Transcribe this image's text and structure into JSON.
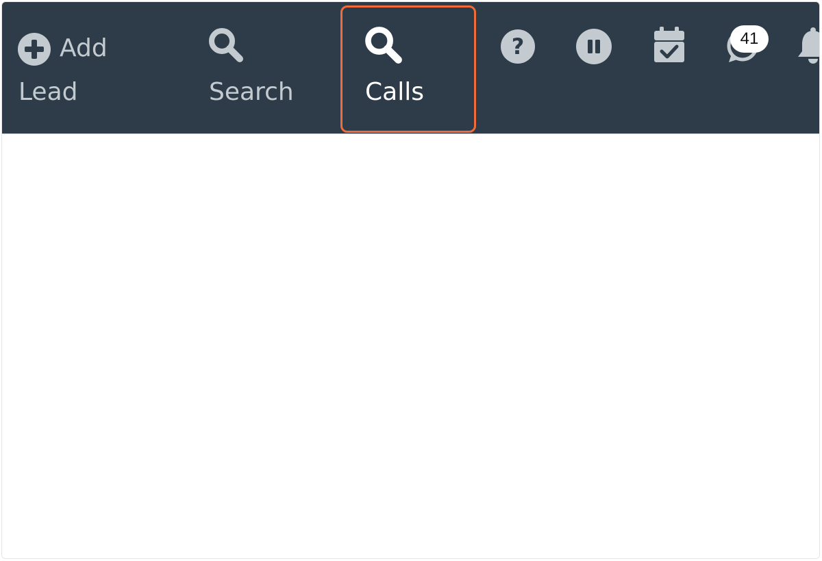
{
  "navbar": {
    "add_lead": {
      "line1": "Add",
      "line2": "Lead",
      "icon": "plus-circle-icon"
    },
    "search": {
      "label": "Search",
      "icon": "search-icon"
    },
    "calls": {
      "label": "Calls",
      "icon": "search-icon",
      "highlighted": true
    },
    "help": {
      "icon": "question-circle-icon"
    },
    "pause": {
      "icon": "pause-circle-icon"
    },
    "calendar": {
      "icon": "calendar-check-icon"
    },
    "messages": {
      "icon": "whatsapp-icon",
      "badge": "41"
    },
    "notifications": {
      "icon": "bell-icon"
    }
  },
  "colors": {
    "navbar_bg": "#2d3c48",
    "nav_text": "#c3cbd1",
    "nav_text_active": "#ffffff",
    "highlight": "#f26b3a"
  }
}
